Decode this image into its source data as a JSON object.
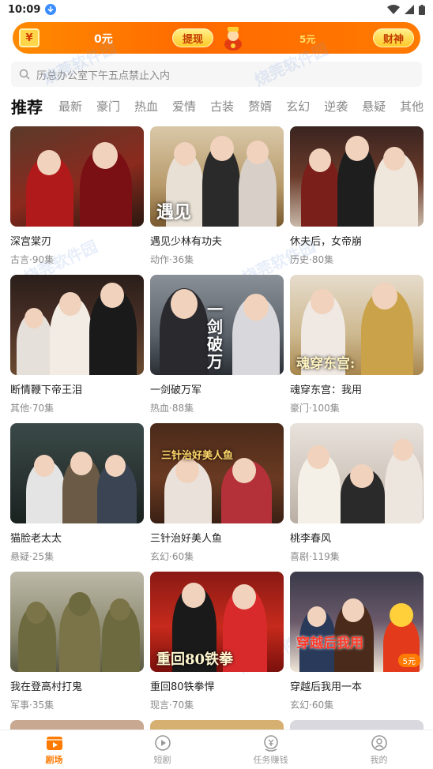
{
  "status_bar": {
    "time": "10:09"
  },
  "banner": {
    "wallet_icon": "wallet-icon",
    "coin_amount": "0元",
    "withdraw_label": "提现",
    "target_amount": "5元",
    "caishen_label": "财神",
    "accent": "#ff7a00"
  },
  "search": {
    "placeholder": "历总办公室下午五点禁止入内"
  },
  "watermark": "烧莞软件园",
  "tabs": [
    "推荐",
    "最新",
    "豪门",
    "热血",
    "爱情",
    "古装",
    "赘婿",
    "玄幻",
    "逆袭",
    "悬疑",
    "其他"
  ],
  "dramas": [
    {
      "title": "深宫棠刃",
      "meta": "古言·90集"
    },
    {
      "title": "遇见少林有功夫",
      "meta": "动作·36集",
      "poster_text": "遇见"
    },
    {
      "title": "休夫后，女帝崩",
      "meta": "历史·80集"
    },
    {
      "title": "断情鞭下帝王泪",
      "meta": "其他·70集"
    },
    {
      "title": "一剑破万军",
      "meta": "热血·88集",
      "poster_text": "一剑破万"
    },
    {
      "title": "魂穿东宫：我用",
      "meta": "豪门·100集",
      "poster_text": "魂穿东宫:"
    },
    {
      "title": "猫脸老太太",
      "meta": "悬疑·25集"
    },
    {
      "title": "三针治好美人鱼",
      "meta": "玄幻·60集",
      "poster_text": "三针治好美人鱼"
    },
    {
      "title": "桃李春风",
      "meta": "喜剧·119集"
    },
    {
      "title": "我在登高村打鬼",
      "meta": "军事·35集"
    },
    {
      "title": "重回80铁拳悍",
      "meta": "现言·70集",
      "poster_text": "重回80铁拳"
    },
    {
      "title": "穿越后我用一本",
      "meta": "玄幻·60集",
      "poster_text": "穿越后我用",
      "price_tag": "5元"
    }
  ],
  "bottom_nav": [
    {
      "label": "剧场",
      "icon": "theater-icon",
      "active": true
    },
    {
      "label": "短剧",
      "icon": "play-circle-icon",
      "active": false
    },
    {
      "label": "任务赚钱",
      "icon": "coin-task-icon",
      "active": false
    },
    {
      "label": "我的",
      "icon": "profile-icon",
      "active": false
    }
  ]
}
